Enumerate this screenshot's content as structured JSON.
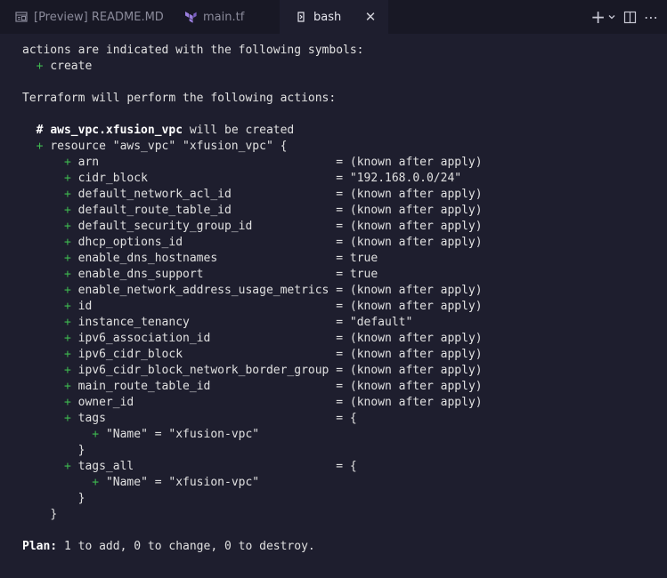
{
  "tabs": [
    {
      "label": "[Preview] README.MD",
      "icon": "preview-icon",
      "active": false
    },
    {
      "label": "main.tf",
      "icon": "terraform-icon",
      "active": false
    },
    {
      "label": "bash",
      "icon": "terminal-icon",
      "active": true
    }
  ],
  "tab_close_glyph": "✕",
  "actions": {
    "new_terminal": "+",
    "dropdown": "⌄",
    "split": "split-editor-icon",
    "more": "⋯"
  },
  "colors": {
    "background": "#1e1e2e",
    "tabbar": "#181825",
    "plus_green": "#3fb950",
    "text": "#e0e0e0"
  },
  "terminal": {
    "intro": "actions are indicated with the following symbols:",
    "create_symbol": "+",
    "create_label": "create",
    "perform": "Terraform will perform the following actions:",
    "resource_comment_prefix": "# ",
    "resource_name": "aws_vpc.xfusion_vpc",
    "resource_comment_suffix": " will be created",
    "resource_decl": "resource \"aws_vpc\" \"xfusion_vpc\" {",
    "attributes": [
      {
        "name": "arn",
        "value": "(known after apply)"
      },
      {
        "name": "cidr_block",
        "value": "\"192.168.0.0/24\""
      },
      {
        "name": "default_network_acl_id",
        "value": "(known after apply)"
      },
      {
        "name": "default_route_table_id",
        "value": "(known after apply)"
      },
      {
        "name": "default_security_group_id",
        "value": "(known after apply)"
      },
      {
        "name": "dhcp_options_id",
        "value": "(known after apply)"
      },
      {
        "name": "enable_dns_hostnames",
        "value": "true"
      },
      {
        "name": "enable_dns_support",
        "value": "true"
      },
      {
        "name": "enable_network_address_usage_metrics",
        "value": "(known after apply)"
      },
      {
        "name": "id",
        "value": "(known after apply)"
      },
      {
        "name": "instance_tenancy",
        "value": "\"default\""
      },
      {
        "name": "ipv6_association_id",
        "value": "(known after apply)"
      },
      {
        "name": "ipv6_cidr_block",
        "value": "(known after apply)"
      },
      {
        "name": "ipv6_cidr_block_network_border_group",
        "value": "(known after apply)"
      },
      {
        "name": "main_route_table_id",
        "value": "(known after apply)"
      },
      {
        "name": "owner_id",
        "value": "(known after apply)"
      }
    ],
    "tags_name": "tags",
    "tags_all_name": "tags_all",
    "map_open": "{",
    "map_close": "}",
    "tag_entry": "\"Name\" = \"xfusion-vpc\"",
    "resource_close": "}",
    "plan_label": "Plan:",
    "plan_text": " 1 to add, 0 to change, 0 to destroy."
  }
}
